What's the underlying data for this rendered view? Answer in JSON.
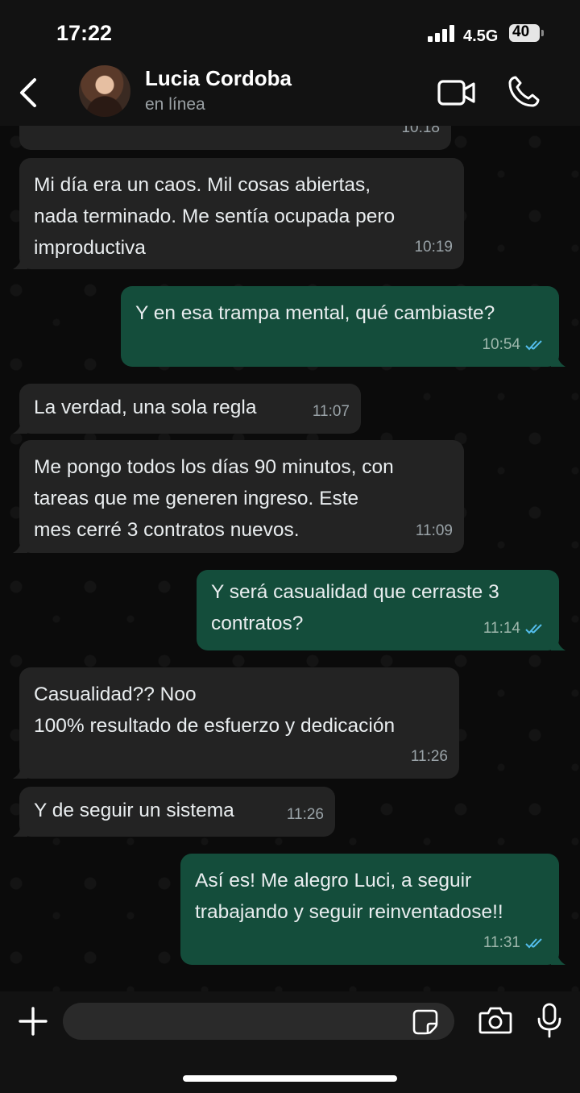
{
  "status_bar": {
    "time": "17:22",
    "network": "4.5G",
    "battery": "40"
  },
  "header": {
    "contact_name": "Lucia Cordoba",
    "contact_status": "en línea"
  },
  "messages": [
    {
      "direction": "in",
      "text": "",
      "time": "10:18"
    },
    {
      "direction": "in",
      "text": "Mi día era un caos. Mil cosas abiertas,\nnada terminado. Me sentía ocupada pero\nimproductiva",
      "time": "10:19"
    },
    {
      "direction": "out",
      "text": "Y en esa trampa mental, qué cambiaste?",
      "time": "10:54",
      "status": "read"
    },
    {
      "direction": "in",
      "text": "La verdad, una sola regla",
      "time": "11:07"
    },
    {
      "direction": "in",
      "text": "Me pongo todos los días 90 minutos, con\ntareas que me generen ingreso. Este\nmes cerré 3 contratos nuevos.",
      "time": "11:09"
    },
    {
      "direction": "out",
      "text": "Y será casualidad que cerraste 3\ncontratos?",
      "time": "11:14",
      "status": "read"
    },
    {
      "direction": "in",
      "text": "Casualidad?? Noo\n100% resultado de esfuerzo y dedicación",
      "time": "11:26"
    },
    {
      "direction": "in",
      "text": "Y de seguir un sistema",
      "time": "11:26"
    },
    {
      "direction": "out",
      "text": "Así es! Me alegro Luci, a seguir\ntrabajando y seguir reinventadose!!",
      "time": "11:31",
      "status": "read"
    }
  ],
  "input": {
    "value": ""
  },
  "colors": {
    "incoming_bubble": "#232323",
    "outgoing_bubble": "#144d3b",
    "read_ticks": "#53bdeb"
  }
}
